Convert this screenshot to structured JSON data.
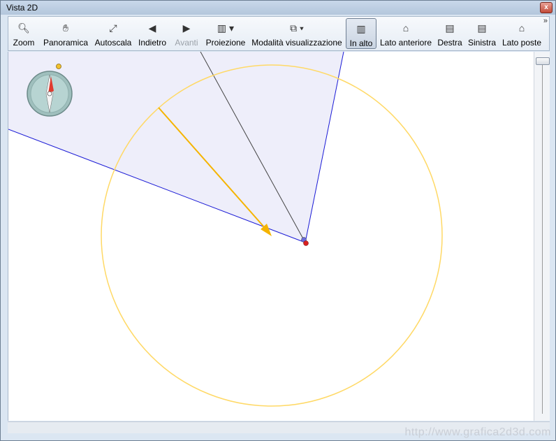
{
  "window": {
    "title": "Vista 2D",
    "close_label": "x"
  },
  "toolbar": {
    "items": [
      {
        "label": "Zoom",
        "icon": "magnifier-icon"
      },
      {
        "label": "Panoramica",
        "icon": "hand-icon"
      },
      {
        "label": "Autoscala",
        "icon": "autoscale-icon"
      },
      {
        "label": "Indietro",
        "icon": "arrow-left-icon"
      },
      {
        "label": "Avanti",
        "icon": "arrow-right-icon",
        "disabled": true
      },
      {
        "label": "Proiezione",
        "icon": "projection-icon"
      },
      {
        "label": "Modalità visualizzazione",
        "icon": "display-mode-icon"
      },
      {
        "label": "In alto",
        "icon": "top-view-icon",
        "active": true
      },
      {
        "label": "Lato anteriore",
        "icon": "front-view-icon"
      },
      {
        "label": "Destra",
        "icon": "right-view-icon"
      },
      {
        "label": "Sinistra",
        "icon": "left-view-icon"
      },
      {
        "label": "Lato poste",
        "icon": "back-view-icon"
      }
    ],
    "overflow": "»"
  },
  "colors": {
    "fov_fill": "#eeeefa",
    "fov_edge": "#1a1ad6",
    "circle": "#ffd966",
    "arrow": "#f5b400",
    "point_red": "#d92020",
    "point_blue": "#6a6adc"
  },
  "watermark": "http://www.grafica2d3d.com"
}
